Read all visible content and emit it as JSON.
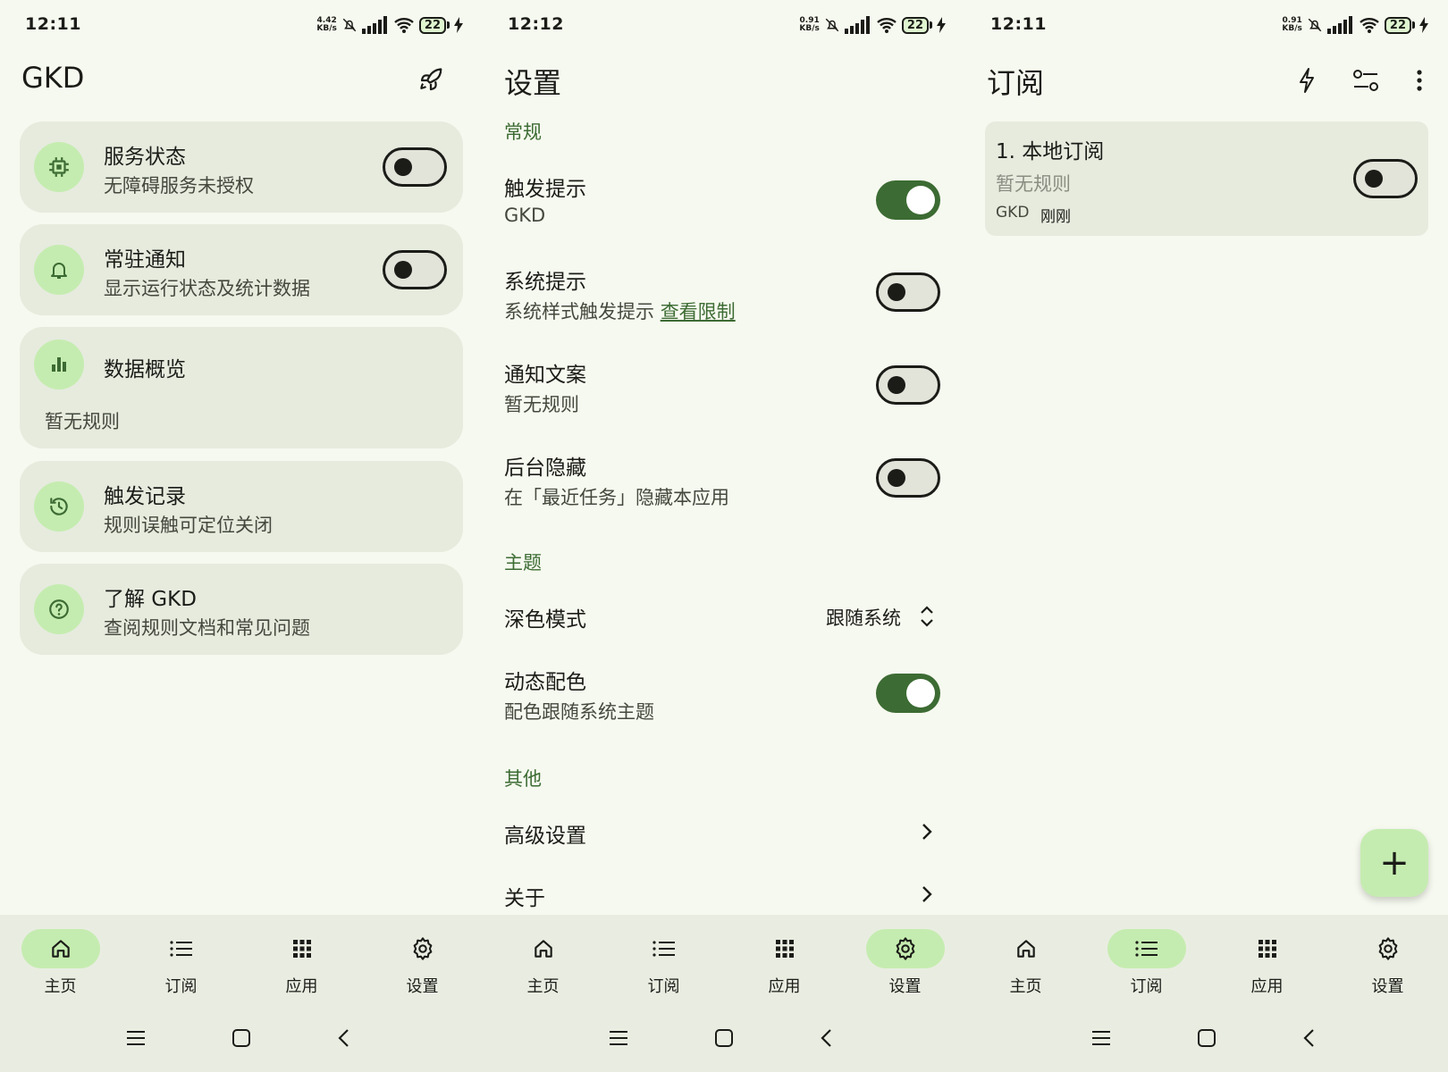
{
  "colors": {
    "primary": "#3c6b33",
    "primary_container": "#c5ecb0",
    "surface": "#f6f9ef",
    "card": "#e6ebde"
  },
  "home": {
    "status": {
      "time": "12:11",
      "speed_top": "4.42",
      "speed_bottom": "KB/s",
      "battery": "22"
    },
    "title": "GKD",
    "cards": [
      {
        "title": "服务状态",
        "subtitle": "无障碍服务未授权",
        "icon": "chip-icon",
        "toggle": false
      },
      {
        "title": "常驻通知",
        "subtitle": "显示运行状态及统计数据",
        "icon": "bell-icon",
        "toggle": false
      },
      {
        "title": "数据概览",
        "subtitle": "暂无规则",
        "icon": "bar-chart-icon"
      },
      {
        "title": "触发记录",
        "subtitle": "规则误触可定位关闭",
        "icon": "history-icon"
      },
      {
        "title": "了解 GKD",
        "subtitle": "查阅规则文档和常见问题",
        "icon": "help-icon"
      }
    ]
  },
  "settings": {
    "status": {
      "time": "12:12",
      "speed_top": "0.91",
      "speed_bottom": "KB/s",
      "battery": "22"
    },
    "title": "设置",
    "section_general": "常规",
    "trigger_tip": {
      "title": "触发提示",
      "subtitle": "GKD",
      "toggle": true
    },
    "system_tip": {
      "title": "系统提示",
      "subtitle": "系统样式触发提示",
      "link": "查看限制",
      "toggle": false
    },
    "notify_copy": {
      "title": "通知文案",
      "subtitle": "暂无规则",
      "toggle": false
    },
    "hide_bg": {
      "title": "后台隐藏",
      "subtitle": "在「最近任务」隐藏本应用",
      "toggle": false
    },
    "section_theme": "主题",
    "dark_mode": {
      "title": "深色模式",
      "value": "跟随系统"
    },
    "dynamic_color": {
      "title": "动态配色",
      "subtitle": "配色跟随系统主题",
      "toggle": true
    },
    "section_other": "其他",
    "advanced": {
      "title": "高级设置"
    },
    "about": {
      "title": "关于"
    }
  },
  "subscription": {
    "status": {
      "time": "12:11",
      "speed_top": "0.91",
      "speed_bottom": "KB/s",
      "battery": "22"
    },
    "title": "订阅",
    "item": {
      "title": "1. 本地订阅",
      "subtitle": "暂无规则",
      "meta_name": "GKD",
      "meta_time": "刚刚",
      "toggle": false
    },
    "fab": "+"
  },
  "nav": {
    "home": "主页",
    "subs": "订阅",
    "apps": "应用",
    "settings": "设置"
  }
}
